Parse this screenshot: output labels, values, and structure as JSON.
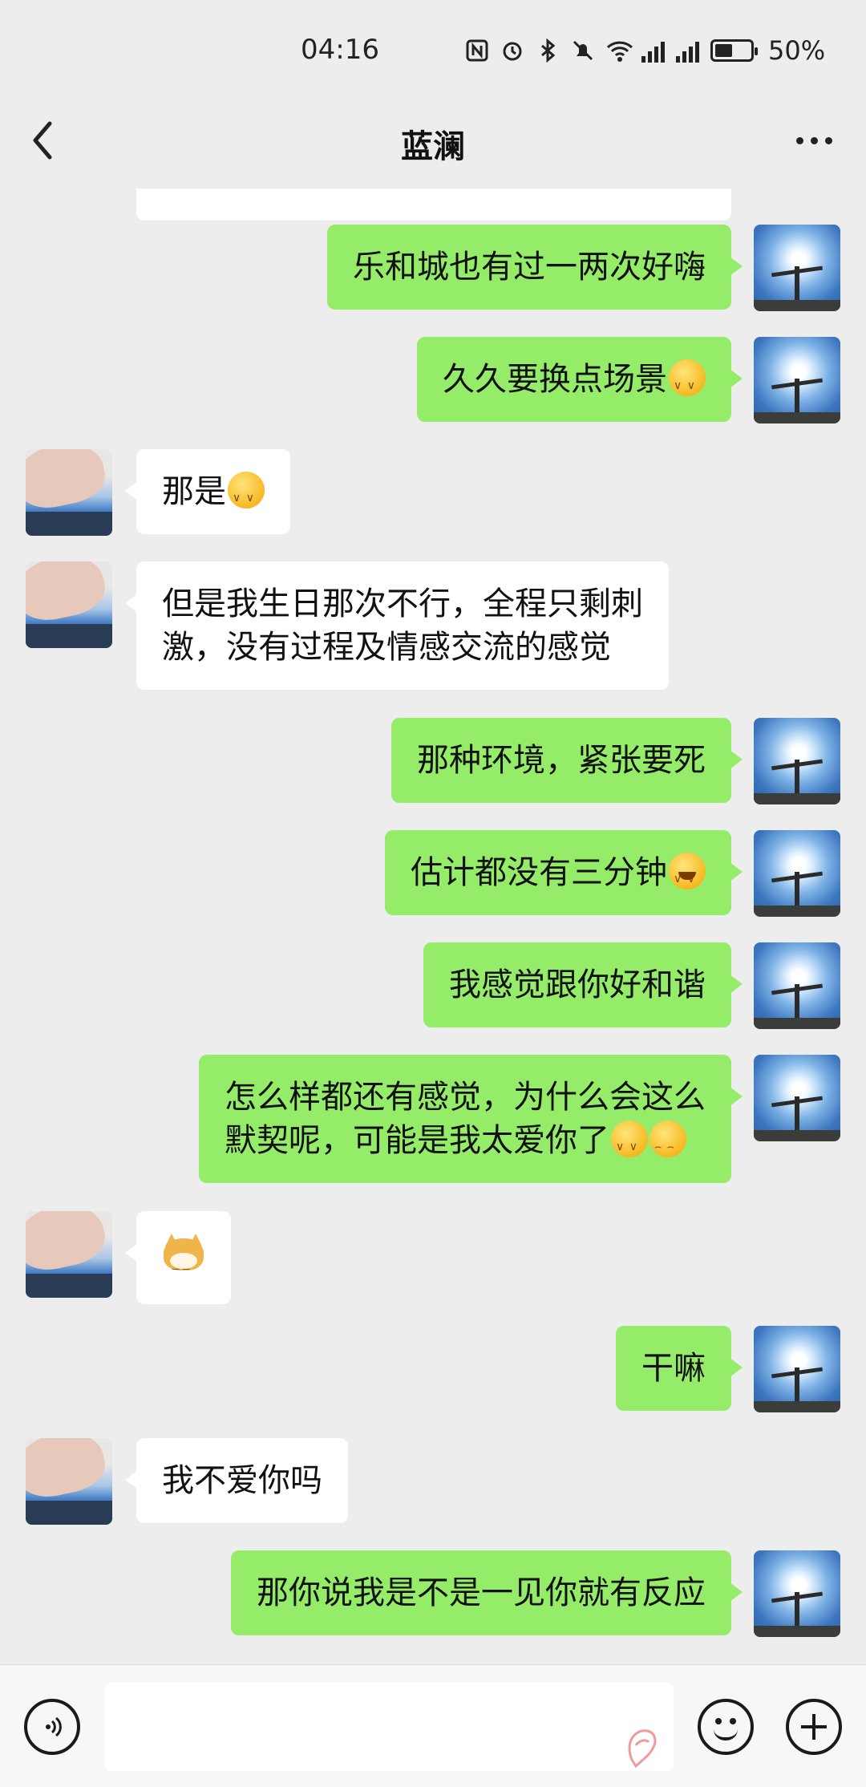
{
  "status_bar": {
    "time": "04:16",
    "battery_percent": "50%",
    "battery_level": 0.5,
    "icons": [
      "nfc-icon",
      "alarm-icon",
      "bluetooth-icon",
      "mute-icon",
      "wifi-icon",
      "signal-5g-icon",
      "signal-4g-icon",
      "battery-icon"
    ]
  },
  "header": {
    "title": "蓝澜"
  },
  "messages": [
    {
      "from": "me",
      "text": "乐和城也有过一两次好嗨"
    },
    {
      "from": "me",
      "text": "久久要换点场景",
      "emoji": "shy-emoji"
    },
    {
      "from": "other",
      "text": "那是",
      "emoji": "shy-emoji"
    },
    {
      "from": "other",
      "text": "但是我生日那次不行，全程只剩刺\n激，没有过程及情感交流的感觉"
    },
    {
      "from": "me",
      "text": "那种环境，紧张要死"
    },
    {
      "from": "me",
      "text": "估计都没有三分钟",
      "emoji": "tears-of-joy-emoji"
    },
    {
      "from": "me",
      "text": "我感觉跟你好和谐"
    },
    {
      "from": "me",
      "text": "怎么样都还有感觉，为什么会这么\n默契呢，可能是我太爱你了",
      "emoji": "shy-emoji,grin-emoji"
    },
    {
      "from": "other",
      "text": "",
      "emoji": "doge-sticker"
    },
    {
      "from": "me",
      "text": "干嘛"
    },
    {
      "from": "other",
      "text": "我不爱你吗"
    },
    {
      "from": "me",
      "text": "那你说我是不是一见你就有反应"
    }
  ],
  "input_bar": {
    "placeholder": "",
    "value": "",
    "icons": [
      "voice-icon",
      "emoji-icon",
      "plus-icon"
    ]
  }
}
